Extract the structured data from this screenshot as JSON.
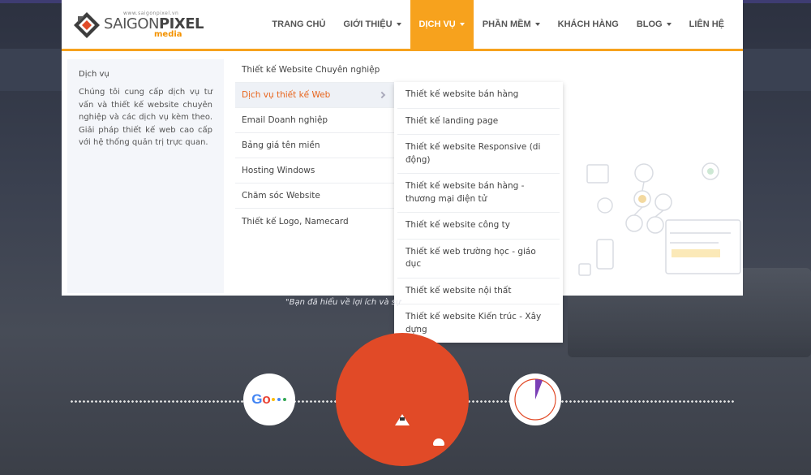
{
  "logo": {
    "small": "www.saigonpixel.vn",
    "brand_light": "SAIGON",
    "brand_bold": "PIXEL",
    "sub": "media"
  },
  "nav": {
    "items": [
      {
        "label": "TRANG CHỦ"
      },
      {
        "label": "GIỚI THIỆU"
      },
      {
        "label": "DỊCH VỤ"
      },
      {
        "label": "PHẦN MỀM"
      },
      {
        "label": "KHÁCH HÀNG"
      },
      {
        "label": "BLOG"
      },
      {
        "label": "LIÊN HỆ"
      }
    ]
  },
  "mega": {
    "intro_title": "Dịch vụ",
    "intro_text": "Chúng tôi cung cấp dịch vụ tư vấn và thiết kế website chuyên nghiệp và các dịch vụ kèm theo. Giải pháp thiết kế web cao cấp với hệ thống quản trị trực quan.",
    "items": [
      {
        "label": "Thiết kế Website Chuyên nghiệp"
      },
      {
        "label": "Dịch vụ thiết kế Web"
      },
      {
        "label": "Email Doanh nghiệp"
      },
      {
        "label": "Bảng giá tên miền"
      },
      {
        "label": "Hosting Windows"
      },
      {
        "label": "Chăm sóc Website"
      },
      {
        "label": "Thiết kế Logo, Namecard"
      }
    ]
  },
  "submenu": {
    "items": [
      {
        "label": "Thiết kế website bán hàng"
      },
      {
        "label": "Thiết kế landing page"
      },
      {
        "label": "Thiết kế website Responsive (di động)"
      },
      {
        "label": "Thiết kế website bán hàng - thương mại điện tử"
      },
      {
        "label": "Thiết kế website công ty"
      },
      {
        "label": "Thiết kế web trường học - giáo dục"
      },
      {
        "label": "Thiết kế website nội thất"
      },
      {
        "label": "Thiết kế website Kiến trúc - Xây dựng"
      }
    ]
  },
  "hero": {
    "quote": "\"Bạn đã hiểu về lợi ích và sự"
  },
  "google": {
    "g": "G",
    "o": "o"
  },
  "colors": {
    "accent": "#f7a21d",
    "active_link": "#e8641b",
    "red_circle": "#e14a27",
    "clock_purple": "#7a3fb6"
  },
  "icons": {
    "caret": "chevron-down-icon",
    "chevron": "chevron-right-icon",
    "logo": "logo-cube-icon"
  }
}
